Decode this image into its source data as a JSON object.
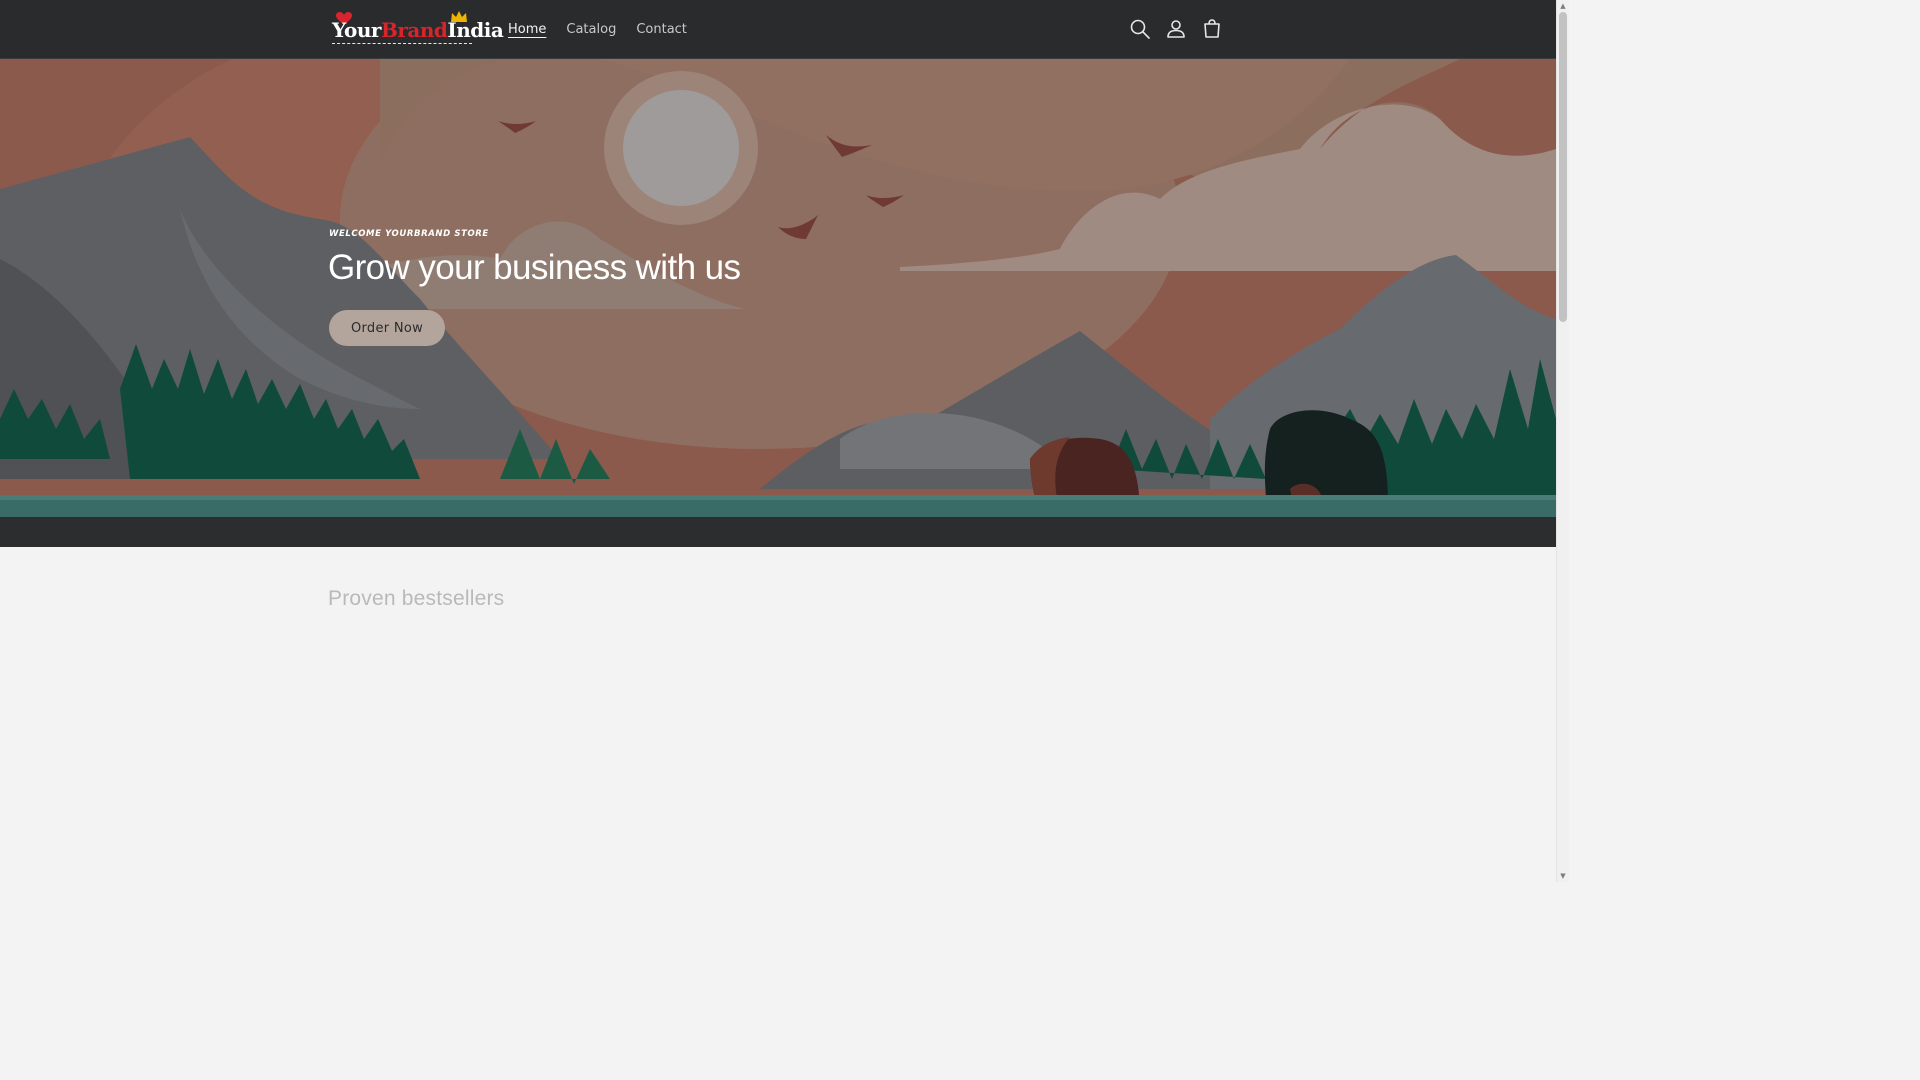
{
  "header": {
    "logo": {
      "word1": "Your",
      "word2": "Brand",
      "word3": "India"
    },
    "nav": [
      {
        "label": "Home",
        "active": true
      },
      {
        "label": "Catalog",
        "active": false
      },
      {
        "label": "Contact",
        "active": false
      }
    ],
    "icons": [
      "search-icon",
      "account-icon",
      "cart-icon"
    ]
  },
  "hero": {
    "eyebrow": "WELCOME YOURBRAND STORE",
    "title": "Grow your business with us",
    "button_label": "Order Now"
  },
  "section": {
    "title": "Proven bestsellers"
  },
  "colors": {
    "header_bg": "#2a2b2d",
    "page_bg": "#f3f3f3",
    "button_bg": "#b3a59b",
    "logo_accent": "#d8242c"
  }
}
